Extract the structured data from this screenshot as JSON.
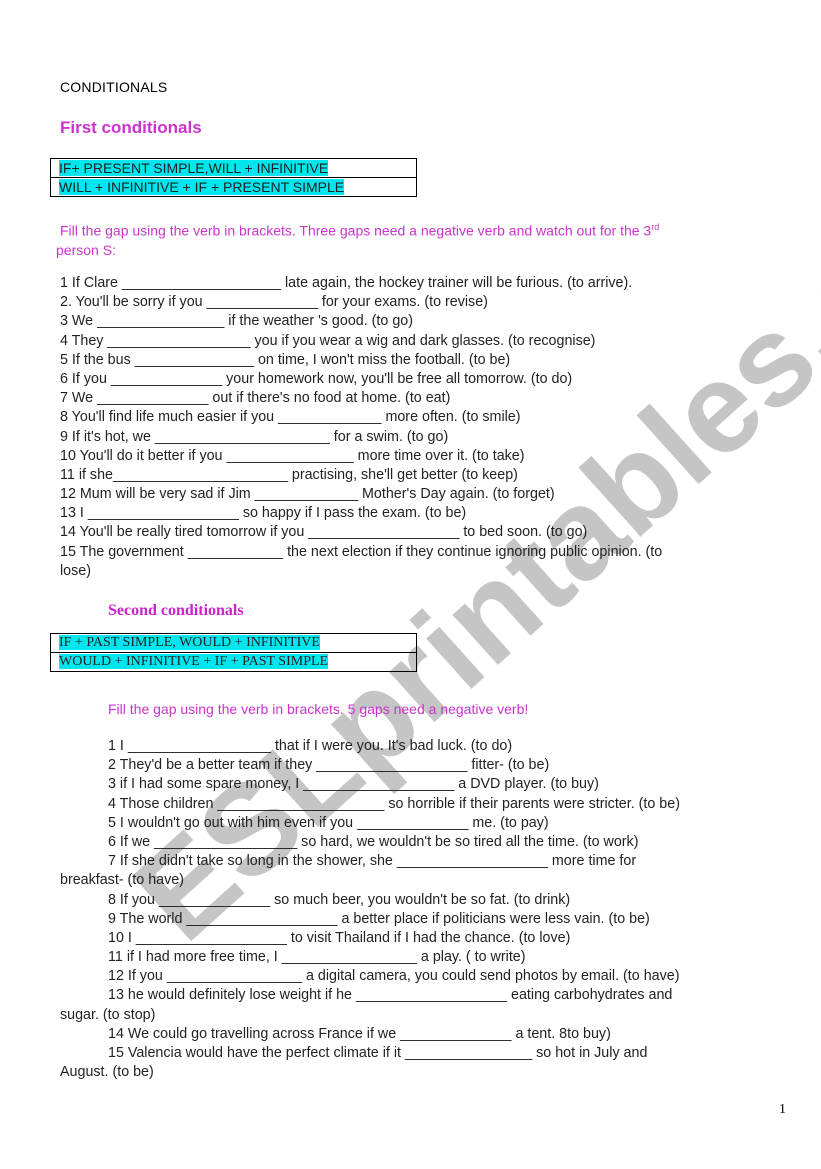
{
  "title": "CONDITIONALS",
  "first": {
    "heading": "First conditionals",
    "formulas": [
      "IF+ PRESENT SIMPLE,WILL + INFINITIVE",
      "WILL + INFINITIVE + IF + PRESENT SIMPLE"
    ],
    "instruction_before_sup": "Fill the gap using the verb in brackets. Three gaps need a negative verb and watch out for the 3",
    "instruction_sup": "rd",
    "instruction_after_sup": " person S:",
    "exercises": [
      "1 If Clare ____________________ late again, the hockey trainer will be furious. (to arrive).",
      "2. You'll be sorry if you ______________ for your exams. (to revise)",
      "3 We ________________ if the weather 's good. (to go)",
      "4 They __________________ you if you wear a wig and dark glasses. (to recognise)",
      "5 If the bus _______________ on time, I won't miss the football. (to be)",
      "6 If you ______________ your homework now, you'll be free all tomorrow. (to do)",
      "7 We ______________ out if there's no food at home. (to eat)",
      "8 You'll find life much easier if you _____________ more often. (to smile)",
      "9 If it's hot, we ______________________ for a swim. (to go)",
      "10 You'll do it better if you ________________ more time over it. (to take)",
      "11 if she______________________ practising, she'll get better (to keep)",
      "12 Mum will be very sad if Jim _____________ Mother's Day again. (to forget)",
      "13 I ___________________ so happy if I pass the exam. (to be)",
      "14 You'll be really tired tomorrow if you ___________________ to bed soon. (to go)",
      "15 The government ____________ the next election if they continue ignoring public opinion. (to",
      "lose)"
    ]
  },
  "second": {
    "heading": "Second conditionals",
    "formulas": [
      "IF + PAST SIMPLE, WOULD + INFINITIVE",
      "WOULD + INFINITIVE + IF + PAST SIMPLE"
    ],
    "instruction": "Fill the gap using the verb in brackets. 5 gaps need a negative verb!",
    "exercises": [
      {
        "text": "1 I __________________ that if I were you. It's bad luck. (to do)",
        "cont": false
      },
      {
        "text": "2 They'd be a better team if they ___________________ fitter- (to be)",
        "cont": false
      },
      {
        "text": "3 if I had some spare money, I ___________________ a DVD player. (to buy)",
        "cont": false
      },
      {
        "text": "4 Those children _____________________ so horrible if their parents were stricter. (to be)",
        "cont": false
      },
      {
        "text": "5 I wouldn't go out with him even if you ______________ me. (to pay)",
        "cont": false
      },
      {
        "text": "6 If we __________________ so hard, we wouldn't be so tired all the time. (to work)",
        "cont": false
      },
      {
        "text": "7 If she didn't take so long in the shower, she ___________________ more time for",
        "cont": false
      },
      {
        "text": "breakfast- (to have)",
        "cont": true
      },
      {
        "text": "8 If you ______________ so much beer, you wouldn't be so fat. (to drink)",
        "cont": false
      },
      {
        "text": "9 The world ___________________ a better place if politicians were less vain. (to be)",
        "cont": false
      },
      {
        "text": "10 I ___________________ to visit Thailand if I had the chance. (to love)",
        "cont": false
      },
      {
        "text": "11 if I had more free time, I _________________ a play. ( to write)",
        "cont": false
      },
      {
        "text": "12 If you _________________ a digital camera, you could send photos by email. (to have)",
        "cont": false
      },
      {
        "text": "13 he would definitely lose weight if he ___________________ eating carbohydrates and",
        "cont": false
      },
      {
        "text": "sugar. (to stop)",
        "cont": true
      },
      {
        "text": "14 We could go travelling across France if we ______________ a tent. 8to buy)",
        "cont": false
      },
      {
        "text": "15 Valencia would have the perfect climate if it ________________ so hot in July and",
        "cont": false
      },
      {
        "text": "August. (to be)",
        "cont": true
      }
    ]
  },
  "watermark": "ESLprintables.com",
  "page_number": "1"
}
